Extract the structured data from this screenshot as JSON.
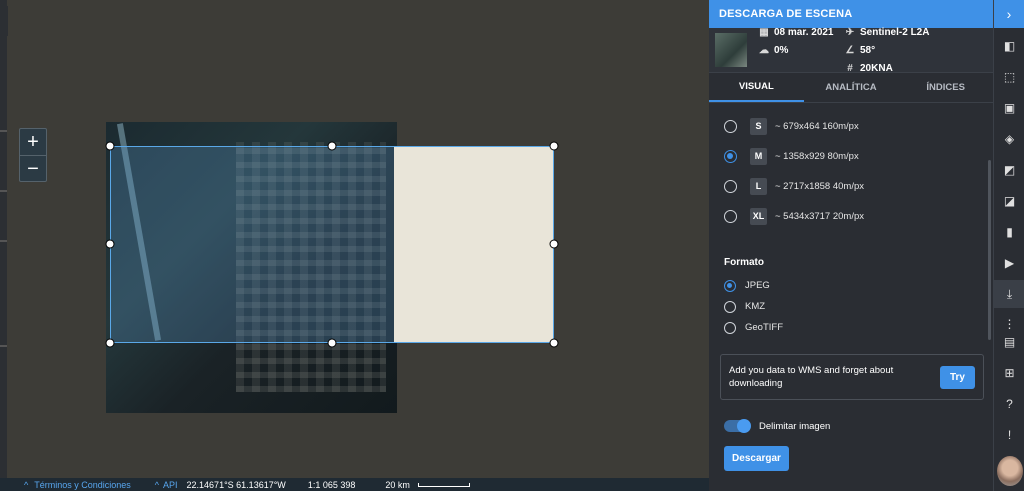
{
  "panel": {
    "title": "DESCARGA DE ESCENA",
    "scene": {
      "date": "08 mar. 2021",
      "satellite": "Sentinel-2 L2A",
      "cloud": "0%",
      "angle": "58°",
      "tile": "20KNA"
    },
    "tabs": [
      {
        "label": "VISUAL"
      },
      {
        "label": "ANALÍTICA"
      },
      {
        "label": "ÍNDICES"
      }
    ],
    "sizes": [
      {
        "badge": "S",
        "text": "~ 679x464 160m/px",
        "selected": false
      },
      {
        "badge": "M",
        "text": "~ 1358x929 80m/px",
        "selected": true
      },
      {
        "badge": "L",
        "text": "~ 2717x1858 40m/px",
        "selected": false
      },
      {
        "badge": "XL",
        "text": "~ 5434x3717 20m/px",
        "selected": false
      }
    ],
    "format": {
      "title": "Formato",
      "options": [
        {
          "label": "JPEG",
          "selected": true
        },
        {
          "label": "KMZ",
          "selected": false
        },
        {
          "label": "GeoTIFF",
          "selected": false
        }
      ]
    },
    "wms": {
      "text": "Add you data to WMS and forget about downloading",
      "button": "Try"
    },
    "toggle_label": "Delimitar imagen",
    "download_button": "Descargar"
  },
  "map": {
    "zoom_in": "+",
    "zoom_out": "−",
    "footer": {
      "terms": "Términos y Condiciones",
      "api": "API",
      "coords": "22.14671°S 61.13617°W",
      "scale_ratio": "1:1 065 398",
      "scale_distance": "20 km"
    }
  },
  "colors": {
    "accent": "#3f91e7",
    "panel_bg": "#2a2d33",
    "map_bg": "#3d3c37"
  }
}
